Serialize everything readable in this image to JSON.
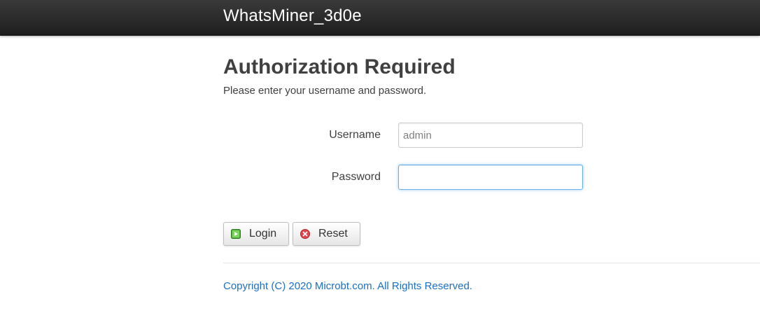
{
  "header": {
    "brand": "WhatsMiner_3d0e",
    "background": "#222222"
  },
  "main": {
    "title": "Authorization Required",
    "description": "Please enter your username and password."
  },
  "form": {
    "username_label": "Username",
    "username_value": "",
    "username_placeholder": "admin",
    "password_label": "Password",
    "password_value": ""
  },
  "buttons": {
    "login_label": "Login",
    "login_icon": "apply-icon",
    "reset_label": "Reset",
    "reset_icon": "reset-icon"
  },
  "footer": {
    "text": "Copyright (C) 2020 Microbt.com. All Rights Reserved.",
    "color": "#1a6fc9"
  }
}
